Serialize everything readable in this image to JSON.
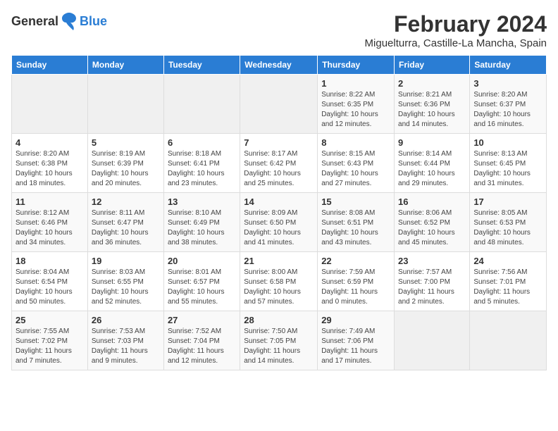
{
  "logo": {
    "general": "General",
    "blue": "Blue"
  },
  "title": {
    "month_year": "February 2024",
    "location": "Miguelturra, Castille-La Mancha, Spain"
  },
  "headers": [
    "Sunday",
    "Monday",
    "Tuesday",
    "Wednesday",
    "Thursday",
    "Friday",
    "Saturday"
  ],
  "weeks": [
    [
      {
        "day": "",
        "info": ""
      },
      {
        "day": "",
        "info": ""
      },
      {
        "day": "",
        "info": ""
      },
      {
        "day": "",
        "info": ""
      },
      {
        "day": "1",
        "info": "Sunrise: 8:22 AM\nSunset: 6:35 PM\nDaylight: 10 hours\nand 12 minutes."
      },
      {
        "day": "2",
        "info": "Sunrise: 8:21 AM\nSunset: 6:36 PM\nDaylight: 10 hours\nand 14 minutes."
      },
      {
        "day": "3",
        "info": "Sunrise: 8:20 AM\nSunset: 6:37 PM\nDaylight: 10 hours\nand 16 minutes."
      }
    ],
    [
      {
        "day": "4",
        "info": "Sunrise: 8:20 AM\nSunset: 6:38 PM\nDaylight: 10 hours\nand 18 minutes."
      },
      {
        "day": "5",
        "info": "Sunrise: 8:19 AM\nSunset: 6:39 PM\nDaylight: 10 hours\nand 20 minutes."
      },
      {
        "day": "6",
        "info": "Sunrise: 8:18 AM\nSunset: 6:41 PM\nDaylight: 10 hours\nand 23 minutes."
      },
      {
        "day": "7",
        "info": "Sunrise: 8:17 AM\nSunset: 6:42 PM\nDaylight: 10 hours\nand 25 minutes."
      },
      {
        "day": "8",
        "info": "Sunrise: 8:15 AM\nSunset: 6:43 PM\nDaylight: 10 hours\nand 27 minutes."
      },
      {
        "day": "9",
        "info": "Sunrise: 8:14 AM\nSunset: 6:44 PM\nDaylight: 10 hours\nand 29 minutes."
      },
      {
        "day": "10",
        "info": "Sunrise: 8:13 AM\nSunset: 6:45 PM\nDaylight: 10 hours\nand 31 minutes."
      }
    ],
    [
      {
        "day": "11",
        "info": "Sunrise: 8:12 AM\nSunset: 6:46 PM\nDaylight: 10 hours\nand 34 minutes."
      },
      {
        "day": "12",
        "info": "Sunrise: 8:11 AM\nSunset: 6:47 PM\nDaylight: 10 hours\nand 36 minutes."
      },
      {
        "day": "13",
        "info": "Sunrise: 8:10 AM\nSunset: 6:49 PM\nDaylight: 10 hours\nand 38 minutes."
      },
      {
        "day": "14",
        "info": "Sunrise: 8:09 AM\nSunset: 6:50 PM\nDaylight: 10 hours\nand 41 minutes."
      },
      {
        "day": "15",
        "info": "Sunrise: 8:08 AM\nSunset: 6:51 PM\nDaylight: 10 hours\nand 43 minutes."
      },
      {
        "day": "16",
        "info": "Sunrise: 8:06 AM\nSunset: 6:52 PM\nDaylight: 10 hours\nand 45 minutes."
      },
      {
        "day": "17",
        "info": "Sunrise: 8:05 AM\nSunset: 6:53 PM\nDaylight: 10 hours\nand 48 minutes."
      }
    ],
    [
      {
        "day": "18",
        "info": "Sunrise: 8:04 AM\nSunset: 6:54 PM\nDaylight: 10 hours\nand 50 minutes."
      },
      {
        "day": "19",
        "info": "Sunrise: 8:03 AM\nSunset: 6:55 PM\nDaylight: 10 hours\nand 52 minutes."
      },
      {
        "day": "20",
        "info": "Sunrise: 8:01 AM\nSunset: 6:57 PM\nDaylight: 10 hours\nand 55 minutes."
      },
      {
        "day": "21",
        "info": "Sunrise: 8:00 AM\nSunset: 6:58 PM\nDaylight: 10 hours\nand 57 minutes."
      },
      {
        "day": "22",
        "info": "Sunrise: 7:59 AM\nSunset: 6:59 PM\nDaylight: 11 hours\nand 0 minutes."
      },
      {
        "day": "23",
        "info": "Sunrise: 7:57 AM\nSunset: 7:00 PM\nDaylight: 11 hours\nand 2 minutes."
      },
      {
        "day": "24",
        "info": "Sunrise: 7:56 AM\nSunset: 7:01 PM\nDaylight: 11 hours\nand 5 minutes."
      }
    ],
    [
      {
        "day": "25",
        "info": "Sunrise: 7:55 AM\nSunset: 7:02 PM\nDaylight: 11 hours\nand 7 minutes."
      },
      {
        "day": "26",
        "info": "Sunrise: 7:53 AM\nSunset: 7:03 PM\nDaylight: 11 hours\nand 9 minutes."
      },
      {
        "day": "27",
        "info": "Sunrise: 7:52 AM\nSunset: 7:04 PM\nDaylight: 11 hours\nand 12 minutes."
      },
      {
        "day": "28",
        "info": "Sunrise: 7:50 AM\nSunset: 7:05 PM\nDaylight: 11 hours\nand 14 minutes."
      },
      {
        "day": "29",
        "info": "Sunrise: 7:49 AM\nSunset: 7:06 PM\nDaylight: 11 hours\nand 17 minutes."
      },
      {
        "day": "",
        "info": ""
      },
      {
        "day": "",
        "info": ""
      }
    ]
  ]
}
